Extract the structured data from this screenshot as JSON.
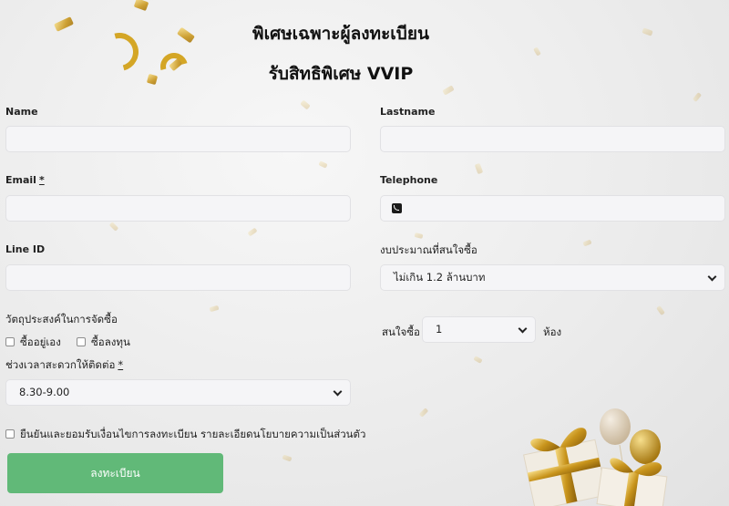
{
  "header": {
    "title": "พิเศษเฉพาะผู้ลงทะเบียน",
    "subtitle": "รับสิทธิพิเศษ VVIP"
  },
  "form": {
    "name_label": "Name",
    "name_value": "",
    "lastname_label": "Lastname",
    "lastname_value": "",
    "email_label": "Email",
    "email_required": "*",
    "email_value": "",
    "telephone_label": "Telephone",
    "telephone_value": "",
    "line_label": "Line ID",
    "line_value": "",
    "budget_label": "งบประมาณที่สนใจซื้อ",
    "budget_value": "ไม่เกิน 1.2 ล้านบาท",
    "purpose_label": "วัตถุประสงค์ในการจัดซื้อ",
    "purpose_options": [
      "ซื้ออยู่เอง",
      "ซื้อลงทุน"
    ],
    "interest_prefix": "สนใจซื้อ",
    "interest_value": "1",
    "interest_suffix": "ห้อง",
    "contact_time_label": "ช่วงเวลาสะดวกให้ติดต่อ",
    "contact_time_required": "*",
    "contact_time_value": "8.30-9.00",
    "consent_text": "ยืนยันและยอมรับเงื่อนไขการลงทะเบียน รายละเอียดนโยบายความเป็นส่วนตัว",
    "submit_label": "ลงทะเบียน"
  },
  "colors": {
    "submit_bg": "#61b978",
    "confetti_gold": "#d4a626",
    "input_bg": "#f5f5f7"
  },
  "icons": {
    "telephone": "phone-icon",
    "dropdown": "chevron-down-icon"
  }
}
